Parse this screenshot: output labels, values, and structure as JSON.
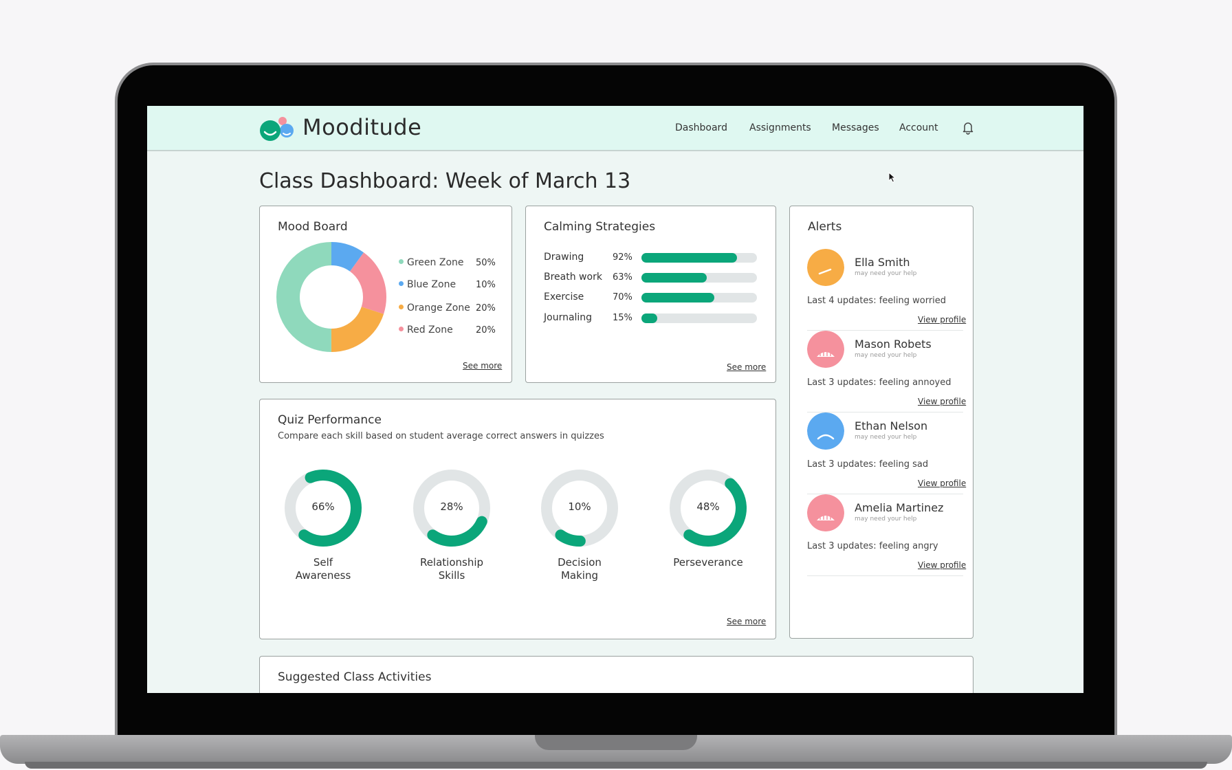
{
  "app": {
    "brand": "Mooditude",
    "nav": [
      "Dashboard",
      "Assignments",
      "Messages",
      "Account"
    ]
  },
  "page": {
    "title": "Class Dashboard: Week of March 13"
  },
  "mood_board": {
    "title": "Mood Board",
    "see_more": "See more",
    "zones": [
      {
        "name": "Green Zone",
        "value": "50%",
        "pct": 50,
        "color": "#8fd9bc"
      },
      {
        "name": "Blue Zone",
        "value": "10%",
        "pct": 10,
        "color": "#5ba9f0"
      },
      {
        "name": "Orange Zone",
        "value": "20%",
        "pct": 20,
        "color": "#f7ac45"
      },
      {
        "name": "Red Zone",
        "value": "20%",
        "pct": 20,
        "color": "#f5919d"
      }
    ]
  },
  "calming": {
    "title": "Calming Strategies",
    "see_more": "See more",
    "items": [
      {
        "label": "Drawing",
        "value": "92%",
        "pct": 92
      },
      {
        "label": "Breath work",
        "value": "63%",
        "pct": 63
      },
      {
        "label": "Exercise",
        "value": "70%",
        "pct": 70
      },
      {
        "label": "Journaling",
        "value": "15%",
        "pct": 15
      }
    ]
  },
  "quiz": {
    "title": "Quiz Performance",
    "subtitle": "Compare each skill based on student average correct answers in quizzes",
    "see_more": "See more",
    "skills": [
      {
        "label": "Self\nAwareness",
        "value": "66%",
        "pct": 66
      },
      {
        "label": "Relationship\nSkills",
        "value": "28%",
        "pct": 28
      },
      {
        "label": "Decision\nMaking",
        "value": "10%",
        "pct": 10
      },
      {
        "label": "Perseverance",
        "value": "48%",
        "pct": 48
      }
    ]
  },
  "alerts": {
    "title": "Alerts",
    "items": [
      {
        "name": "Ella Smith",
        "sub": "may need your help",
        "text": "Last 4 updates: feeling worried",
        "link": "View profile",
        "color": "#f7ac45",
        "mood": "worried"
      },
      {
        "name": "Mason Robets",
        "sub": "may need your help",
        "text": "Last 3 updates: feeling annoyed",
        "link": "View profile",
        "color": "#f5919d",
        "mood": "annoyed"
      },
      {
        "name": "Ethan Nelson",
        "sub": "may need your help",
        "text": "Last 3 updates: feeling sad",
        "link": "View profile",
        "color": "#5ba9f0",
        "mood": "sad"
      },
      {
        "name": "Amelia Martinez",
        "sub": "may need your help",
        "text": "Last 3 updates: feeling angry",
        "link": "View profile",
        "color": "#f5919d",
        "mood": "angry"
      }
    ]
  },
  "activities": {
    "title": "Suggested Class Activities"
  }
}
